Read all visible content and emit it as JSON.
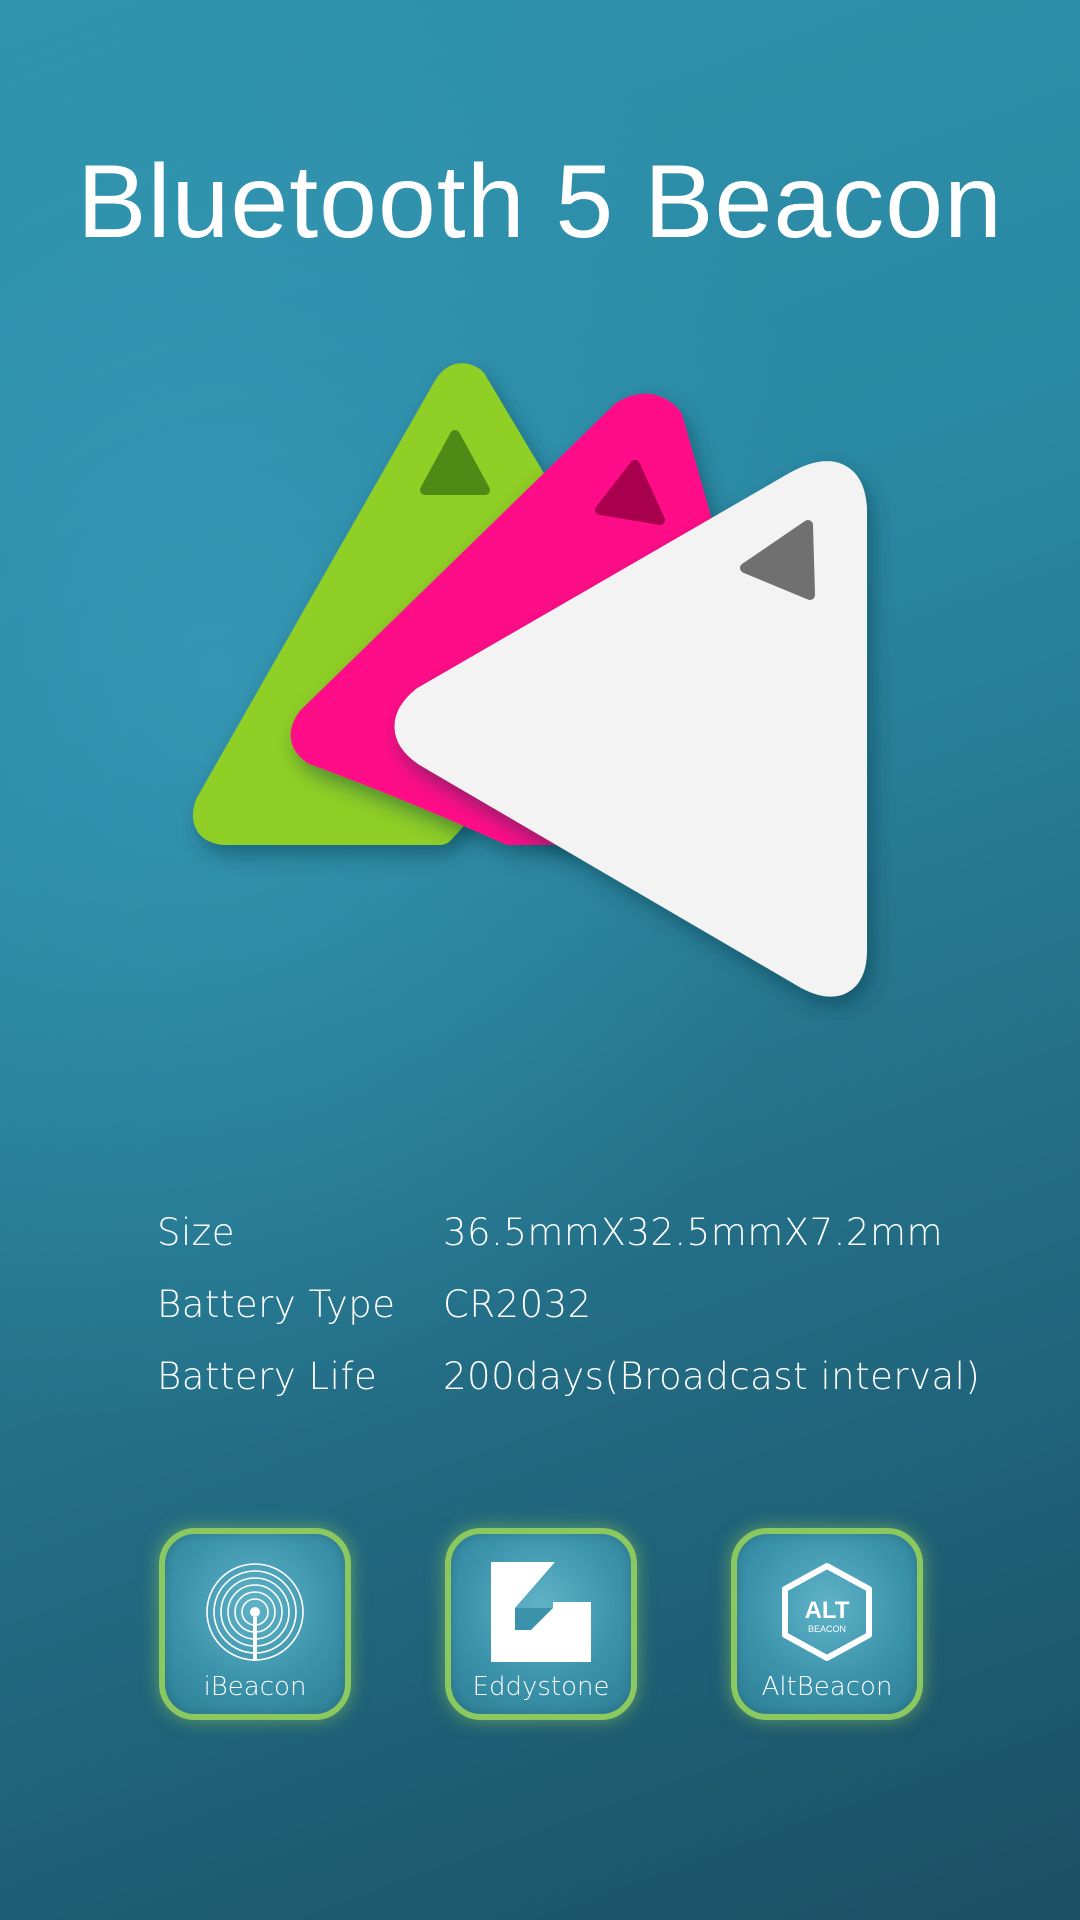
{
  "header": {
    "title": "Bluetooth 5 Beacon"
  },
  "product": {
    "colors": [
      "#8fcf27",
      "#ff0a88",
      "#f3f3f3"
    ]
  },
  "specs": [
    {
      "label": "Size",
      "value": "36.5mmX32.5mmX7.2mm"
    },
    {
      "label": "Battery Type",
      "value": "CR2032"
    },
    {
      "label": "Battery Life",
      "value": "200days(Broadcast interval)"
    }
  ],
  "badges": [
    {
      "label": "iBeacon",
      "icon": "ibeacon-icon"
    },
    {
      "label": "Eddystone",
      "icon": "eddystone-icon"
    },
    {
      "label": "AltBeacon",
      "icon": "altbeacon-icon",
      "icon_text": "ALT",
      "icon_subtext": "BEACON"
    }
  ],
  "theme": {
    "badge_border": "#8cc860",
    "background": "#2a88a3"
  }
}
